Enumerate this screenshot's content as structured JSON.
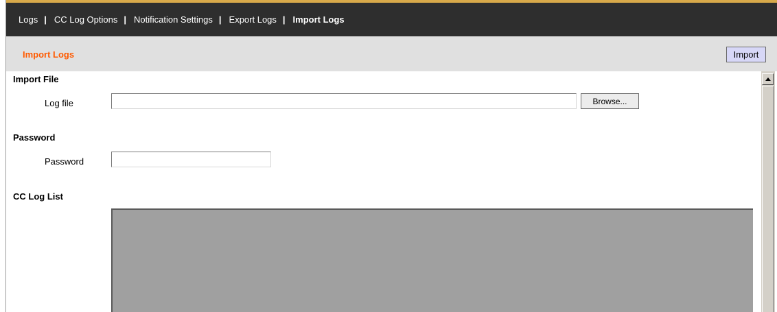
{
  "nav": {
    "items": [
      {
        "label": "Logs",
        "active": false
      },
      {
        "label": "CC Log Options",
        "active": false
      },
      {
        "label": "Notification Settings",
        "active": false
      },
      {
        "label": "Export Logs",
        "active": false
      },
      {
        "label": "Import Logs",
        "active": true
      }
    ],
    "separator": "|"
  },
  "header": {
    "title": "Import Logs",
    "import_button": "Import"
  },
  "import_file": {
    "heading": "Import File",
    "log_file_label": "Log file",
    "log_file_value": "",
    "browse_button": "Browse..."
  },
  "password": {
    "heading": "Password",
    "label": "Password",
    "value": ""
  },
  "cc_log_list": {
    "heading": "CC Log List"
  },
  "colors": {
    "nav_background": "#2e2e2e",
    "title_accent": "#ff5a00",
    "import_button_bg": "#d7d7f7",
    "list_background": "#a0a0a0"
  }
}
